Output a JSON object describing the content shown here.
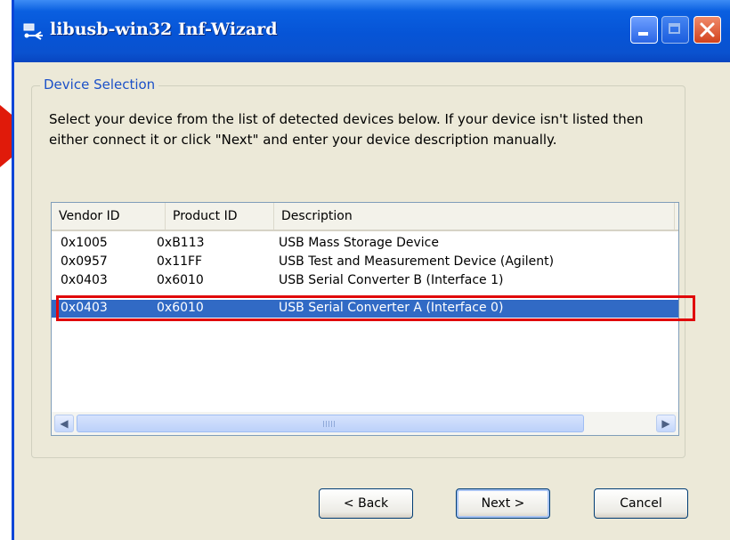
{
  "window": {
    "title": "libusb-win32 Inf-Wizard"
  },
  "group": {
    "legend": "Device Selection"
  },
  "instructions": "Select your device from the list of detected devices below. If your device isn't listed then either connect it or click \"Next\" and enter your device description manually.",
  "device_list": {
    "columns": [
      "Vendor ID",
      "Product ID",
      "Description"
    ],
    "rows": [
      {
        "vendor": "0x1005",
        "product": "0xB113",
        "description": "USB Mass Storage Device"
      },
      {
        "vendor": "0x0957",
        "product": "0x11FF",
        "description": "USB Test and Measurement Device (Agilent)"
      },
      {
        "vendor": "0x0403",
        "product": "0x6010",
        "description": "USB Serial Converter B (Interface 1)"
      },
      {
        "vendor": "0x0403",
        "product": "0x6010",
        "description": "USB Serial Converter A (Interface 0)",
        "selected": true
      }
    ]
  },
  "buttons": {
    "back": "< Back",
    "next": "Next >",
    "cancel": "Cancel"
  },
  "colors": {
    "titlebar": "#0654d6",
    "selection": "#316ac5",
    "highlight": "#e0070a",
    "arrow": "#e01a0a"
  }
}
